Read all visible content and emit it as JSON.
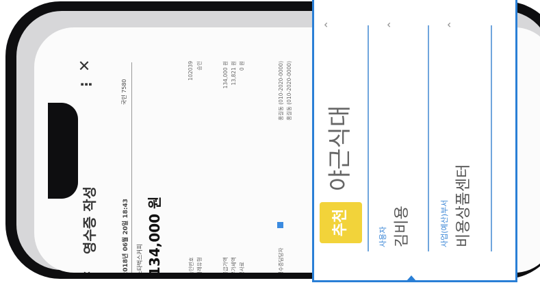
{
  "screen": {
    "title": "영수증 작성",
    "date": "2018년 06월 20일 18:43",
    "card": "국민 7580",
    "merchant": "스타벅스커피",
    "amount": "134,000 원",
    "details": [
      {
        "label": "승인번호",
        "value": "102039"
      },
      {
        "label": "거래유형",
        "value": "승인"
      },
      {
        "label": "공급가액",
        "value": "134,000 원"
      },
      {
        "label": "부가세액",
        "value": "13,821 원"
      },
      {
        "label": "봉사료",
        "value": "0 원"
      }
    ],
    "register": {
      "label": "영수증담당자",
      "lines": [
        "홍길동 (010-2020-0000)",
        "홍길동 (010-2020-0000)"
      ]
    }
  },
  "dropdown": {
    "badge": "추천",
    "title": "야근식대",
    "user_label": "사용자",
    "user_name": "김비용",
    "dept_label": "사업(예산)부서",
    "dept_name": "비용상품센터"
  },
  "icons": {
    "back": "‹",
    "more": "⋮",
    "close": "✕",
    "caret": "⌃"
  },
  "colors": {
    "accent": "#2a7fd6",
    "badge": "#f2d33a"
  }
}
